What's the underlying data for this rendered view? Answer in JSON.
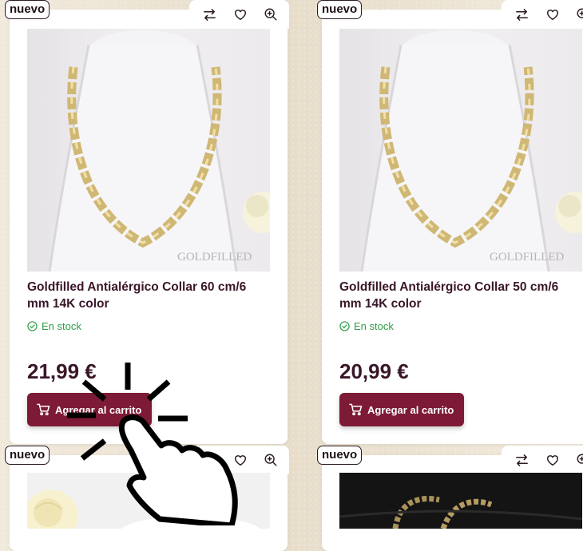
{
  "badge_label": "nuevo",
  "stock_label": "En stock",
  "cart_label": "Agregar al carrito",
  "watermark": "GOLDFILLED",
  "products": [
    {
      "title": "Goldfilled Antialérgico Collar 60 cm/6 mm 14K color",
      "price": "21,99 €"
    },
    {
      "title": "Goldfilled Antialérgico Collar 50 cm/6 mm 14K color",
      "price": "20,99 €"
    }
  ],
  "icons": [
    "compare-icon",
    "heart-icon",
    "zoom-in-icon",
    "check-circle-icon",
    "cart-icon",
    "pointing-hand-icon"
  ],
  "colors": {
    "accent": "#7d1a35",
    "title": "#3a1628",
    "stock": "#2e9e48",
    "background": "#efe6d6"
  }
}
